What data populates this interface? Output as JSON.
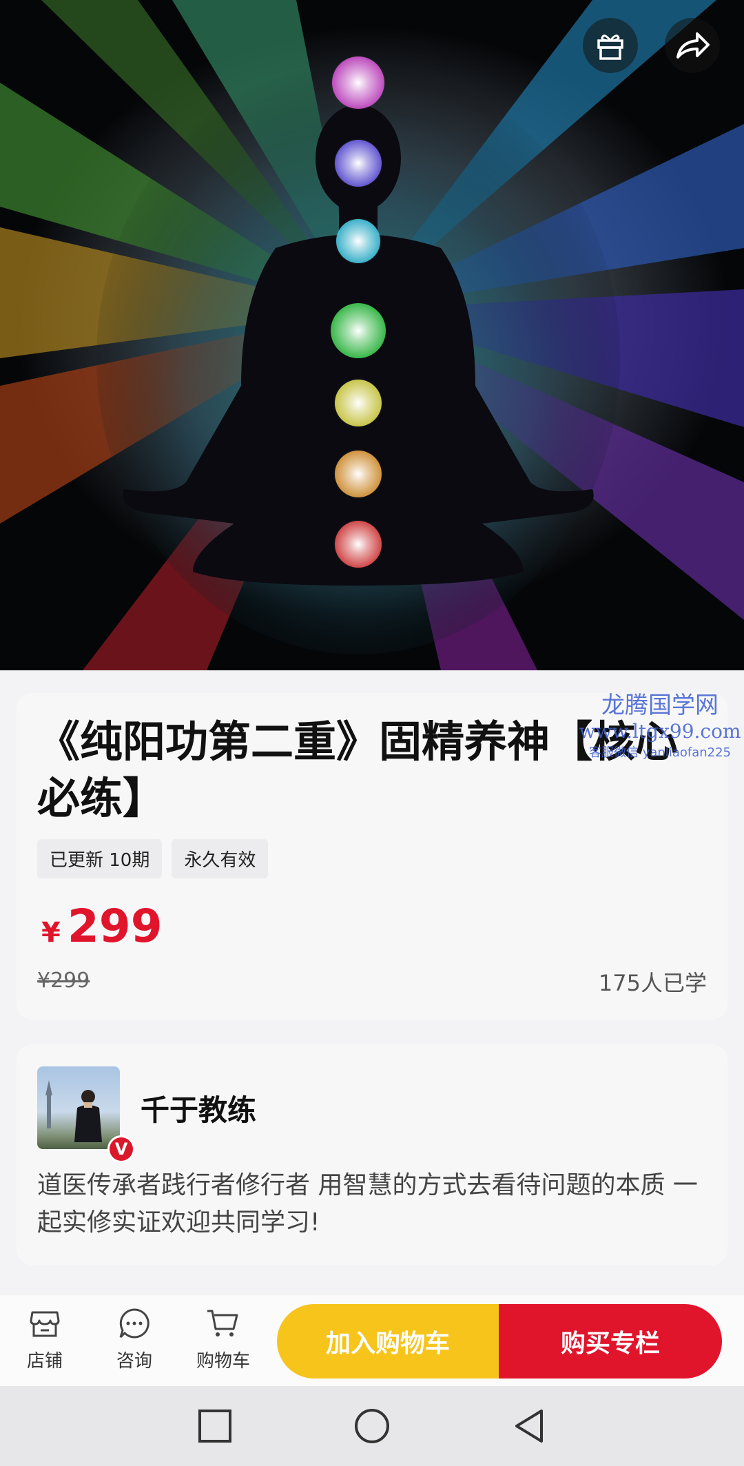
{
  "hero": {
    "gift_icon": "gift-icon",
    "share_icon": "share-icon"
  },
  "course": {
    "title": "《纯阳功第二重》固精养神【核心必练】",
    "tags": [
      "已更新 10期",
      "永久有效"
    ],
    "price_currency": "¥",
    "price": "299",
    "original_price": "¥299",
    "learners": "175人已学"
  },
  "watermark": {
    "line1": "龙腾国学网",
    "line2": "www.ltgx99.com",
    "line3": "客服微信 yanliaofan225"
  },
  "instructor": {
    "badge": "V",
    "name": "千于教练",
    "bio": "道医传承者践行者修行者 用智慧的方式去看待问题的本质 一起实修实证欢迎共同学习!"
  },
  "bottom_bar": {
    "store": "店铺",
    "consult": "咨询",
    "cart": "购物车",
    "add_to_cart": "加入购物车",
    "buy": "购买专栏"
  },
  "colors": {
    "accent_red": "#e0142b",
    "accent_yellow": "#f6c41b"
  }
}
